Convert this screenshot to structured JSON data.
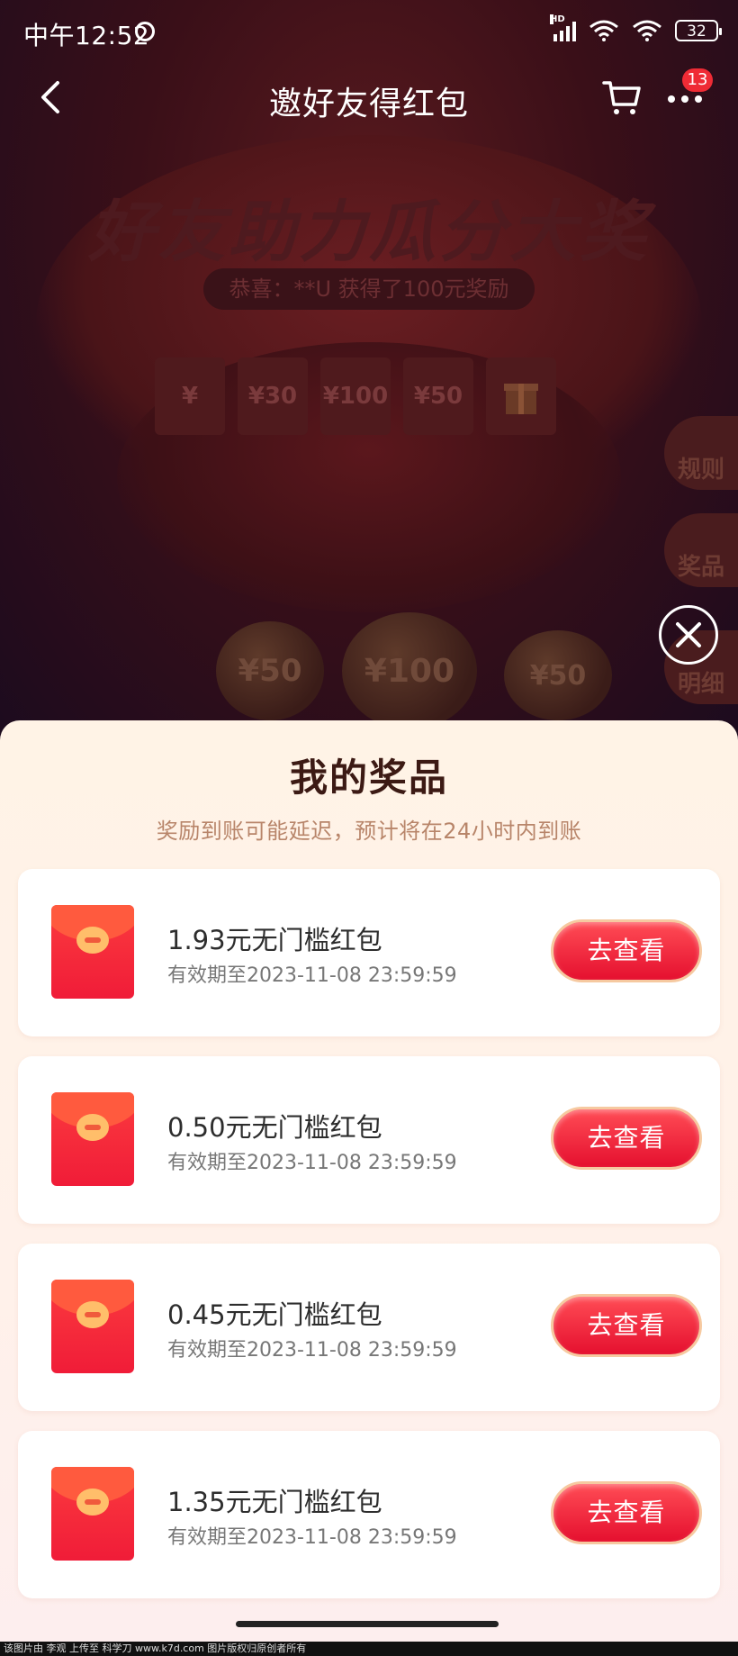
{
  "status_bar": {
    "time": "中午12:52",
    "network": "HD",
    "battery": "32"
  },
  "header": {
    "title": "邀好友得红包",
    "badge_count": "13"
  },
  "background": {
    "headline": "好友助力瓜分大奖",
    "winner_text": "恭喜：**U 获得了100元奖励",
    "prizes": [
      "¥30",
      "¥100",
      "¥50"
    ],
    "side_buttons": [
      "规则",
      "奖品",
      "明细"
    ],
    "balls": [
      "¥50",
      "¥100",
      "¥50"
    ]
  },
  "sheet": {
    "title": "我的奖品",
    "subtitle": "奖励到账可能延迟，预计将在24小时内到账",
    "items": [
      {
        "name": "1.93元无门槛红包",
        "expiry": "有效期至2023-11-08 23:59:59",
        "button": "去查看"
      },
      {
        "name": "0.50元无门槛红包",
        "expiry": "有效期至2023-11-08 23:59:59",
        "button": "去查看"
      },
      {
        "name": "0.45元无门槛红包",
        "expiry": "有效期至2023-11-08 23:59:59",
        "button": "去查看"
      },
      {
        "name": "1.35元无门槛红包",
        "expiry": "有效期至2023-11-08 23:59:59",
        "button": "去查看"
      }
    ]
  },
  "watermark": "该图片由 李观 上传至 科学刀 www.k7d.com 图片版权归原创者所有",
  "colors": {
    "accent": "#e5102f",
    "sheet_bg": "#fff3e6",
    "subtitle": "#b8856a"
  }
}
